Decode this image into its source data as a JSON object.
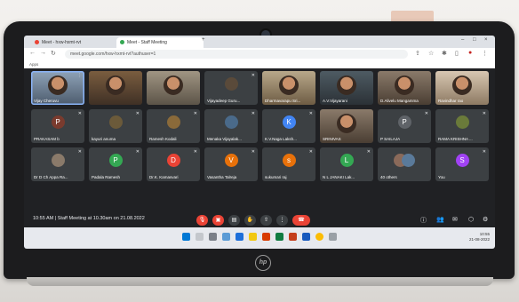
{
  "browser": {
    "tabs": [
      {
        "label": "Meet - hxw-hxmt-rvt",
        "dot_color": "#ea4335"
      },
      {
        "label": "Meet - Staff Meeting",
        "dot_color": "#34a853"
      }
    ],
    "url": "meet.google.com/hxw-hxmt-rvt?authuser=1",
    "bookmark": "Apps"
  },
  "participants": [
    {
      "name": "Vijay Cheruvu",
      "type": "video",
      "bg": "video-bg-1"
    },
    {
      "name": "",
      "type": "video",
      "bg": "video-bg-2"
    },
    {
      "name": "",
      "type": "video",
      "bg": "video-bg-3"
    },
    {
      "name": "Vijayadeep Guru...",
      "type": "avatar",
      "initial": "",
      "color": "#5a4a3a"
    },
    {
      "name": "Dharmavarapu Sri...",
      "type": "video",
      "bg": "video-bg-4"
    },
    {
      "name": "A.V.Vijayarani",
      "type": "video",
      "bg": "video-bg-5"
    },
    {
      "name": "D.Alivelu Mangamma",
      "type": "video",
      "bg": "video-bg-6"
    },
    {
      "name": "Ravindhar rao",
      "type": "video",
      "bg": "video-bg-7"
    },
    {
      "name": "PRAKASAM b",
      "type": "avatar",
      "initial": "P",
      "color": "#7a3b2e"
    },
    {
      "name": "kayuri anuma",
      "type": "avatar",
      "initial": "",
      "color": "#6b5a3a"
    },
    {
      "name": "Ramesh Kodali",
      "type": "avatar",
      "initial": "",
      "color": "#8a6a3a"
    },
    {
      "name": "Menaka Vijayalak...",
      "type": "avatar",
      "initial": "",
      "color": "#4a6a8a"
    },
    {
      "name": "K.V.Naga Laksh...",
      "type": "avatar",
      "initial": "K",
      "color": "#4285f4"
    },
    {
      "name": "SRINIVAS",
      "type": "video",
      "bg": "video-bg-6"
    },
    {
      "name": "P SAILAJA",
      "type": "avatar",
      "initial": "P",
      "color": "#5f6368"
    },
    {
      "name": "RAMA KRISHNA ...",
      "type": "avatar",
      "initial": "",
      "color": "#6a7a3a"
    },
    {
      "name": "Dr D Ch Appa Ra...",
      "type": "avatar",
      "initial": "",
      "color": "#8a7a6a"
    },
    {
      "name": "Padala Ramesh",
      "type": "avatar",
      "initial": "P",
      "color": "#34a853"
    },
    {
      "name": "Dr.K. Kamasvari",
      "type": "avatar",
      "initial": "D",
      "color": "#ea4335"
    },
    {
      "name": "Vasantha Talreja",
      "type": "avatar",
      "initial": "V",
      "color": "#e8710a"
    },
    {
      "name": "sukumari raj",
      "type": "avatar",
      "initial": "s",
      "color": "#e8710a"
    },
    {
      "name": "N L JANAKI Lak...",
      "type": "avatar",
      "initial": "L",
      "color": "#34a853"
    },
    {
      "name": "40 others",
      "type": "others",
      "initial": "",
      "color": "#3c4043"
    },
    {
      "name": "You",
      "type": "avatar",
      "initial": "S",
      "color": "#a142f4"
    }
  ],
  "meeting": {
    "time": "10:55 AM",
    "separator": "|",
    "title": "Staff Meeting at 10.30am on 21.08.2022"
  },
  "taskbar": {
    "time": "10:55",
    "date": "21-08-2022"
  },
  "brand": "hp"
}
